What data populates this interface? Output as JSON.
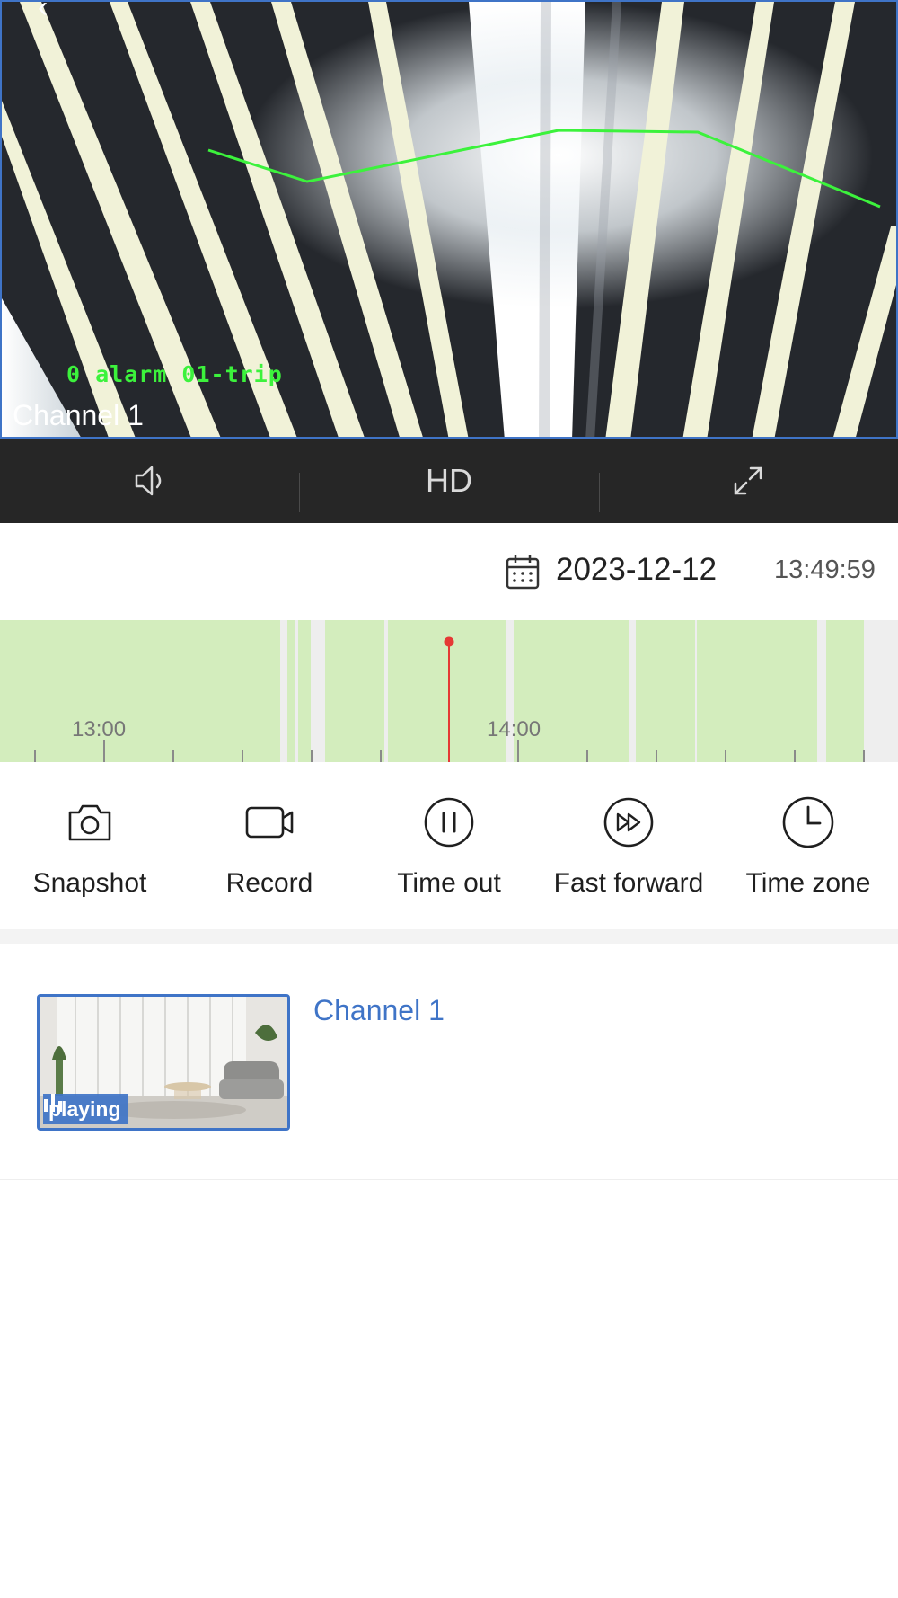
{
  "video": {
    "osd_alarm": "0 alarm 01-trip",
    "osd_channel": "Channel 1"
  },
  "controls": {
    "sound_icon": "speaker-icon",
    "quality_label": "HD",
    "fullscreen_icon": "expand-icon"
  },
  "date_row": {
    "calendar_icon": "calendar-icon",
    "date": "2023-12-12",
    "time": "13:49:59"
  },
  "timeline": {
    "labels": [
      "13:00",
      "14:00"
    ],
    "recorded_color": "#d3edbd",
    "gap_color": "#eeeeee",
    "cursor_color": "#e53935"
  },
  "actions": [
    {
      "label": "Snapshot",
      "icon": "camera-icon"
    },
    {
      "label": "Record",
      "icon": "video-camera-icon"
    },
    {
      "label": "Time out",
      "icon": "pause-icon"
    },
    {
      "label": "Fast forward",
      "icon": "fast-forward-icon"
    },
    {
      "label": "Time zone",
      "icon": "clock-icon"
    }
  ],
  "channels": [
    {
      "name": "Channel 1",
      "status": "playing"
    }
  ],
  "colors": {
    "accent": "#3f74c7",
    "control_bar": "#262626"
  }
}
